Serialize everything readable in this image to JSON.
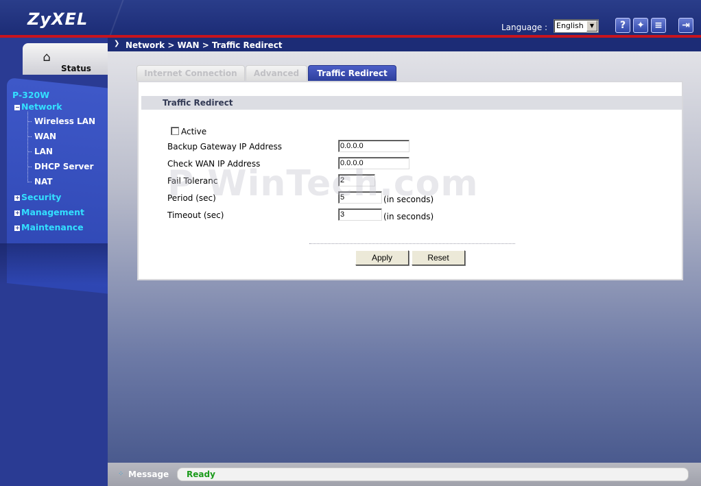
{
  "header": {
    "logo": "ZyXEL",
    "language_label": "Language :",
    "language_value": "English",
    "icons": [
      "help-icon",
      "wizard-icon",
      "sitemap-icon",
      "logout-icon"
    ]
  },
  "sidebar": {
    "status_label": "Status",
    "device": "P-320W",
    "network": "Network",
    "network_items": [
      "Wireless LAN",
      "WAN",
      "LAN",
      "DHCP Server",
      "NAT"
    ],
    "security": "Security",
    "management": "Management",
    "maintenance": "Maintenance"
  },
  "breadcrumb": "Network > WAN > Traffic Redirect",
  "tabs": [
    {
      "label": "Internet Connection",
      "active": false
    },
    {
      "label": "Advanced",
      "active": false
    },
    {
      "label": "Traffic Redirect",
      "active": true
    }
  ],
  "form": {
    "section_title": "Traffic Redirect",
    "active_label": "Active",
    "active_checked": false,
    "backup_gateway_label": "Backup Gateway IP Address",
    "backup_gateway_value": "0.0.0.0",
    "check_wan_label": "Check WAN IP Address",
    "check_wan_value": "0.0.0.0",
    "fail_tolerance_label": "Fail Toleranc",
    "fail_tolerance_value": "2",
    "period_label": "Period (sec)",
    "period_value": "5",
    "period_unit": "(in seconds)",
    "timeout_label": "Timeout (sec)",
    "timeout_value": "3",
    "timeout_unit": "(in seconds)",
    "apply_label": "Apply",
    "reset_label": "Reset"
  },
  "watermark": "P WinTech.com",
  "footer": {
    "message_label": "Message",
    "message_text": "Ready"
  },
  "colors": {
    "header_bg": "#1c2c76",
    "accent_red": "#c8141e",
    "nav_cyan": "#33e0ff",
    "status_green": "#1a9a1a"
  }
}
